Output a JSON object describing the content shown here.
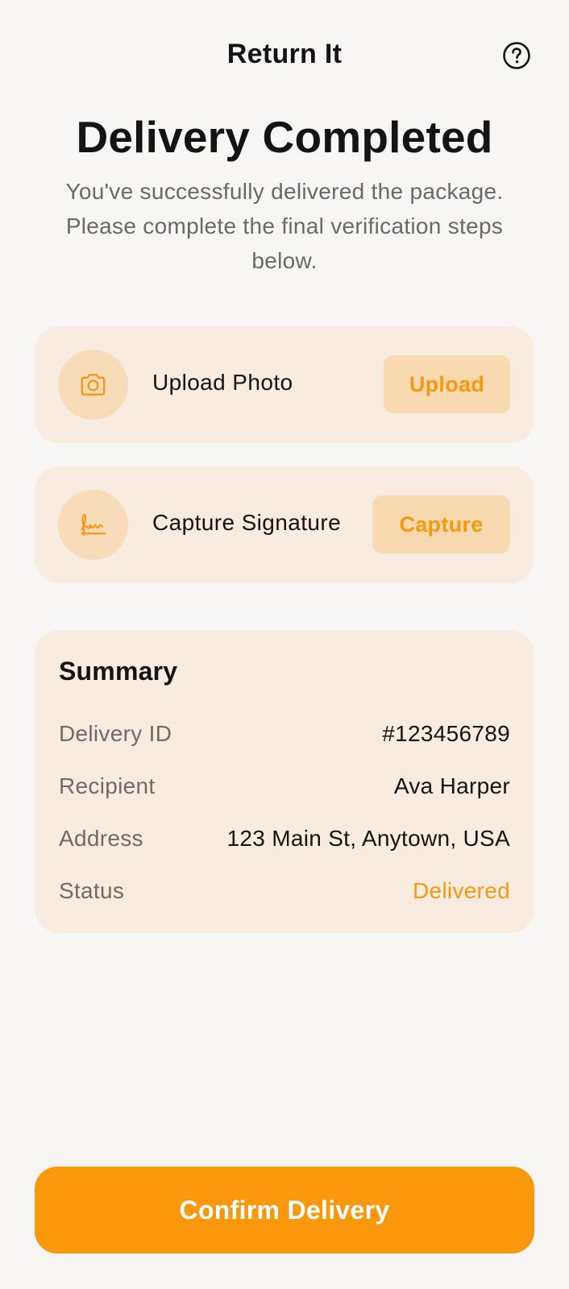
{
  "header": {
    "title": "Return It",
    "help_icon": "help-circle-icon"
  },
  "main": {
    "title": "Delivery Completed",
    "subtitle": "You've successfully delivered the package. Please complete the final verification steps below."
  },
  "actions": [
    {
      "icon": "camera-icon",
      "label": "Upload Photo",
      "button": "Upload"
    },
    {
      "icon": "signature-icon",
      "label": "Capture Signature",
      "button": "Capture"
    }
  ],
  "summary": {
    "title": "Summary",
    "rows": [
      {
        "label": "Delivery ID",
        "value": "#123456789"
      },
      {
        "label": "Recipient",
        "value": "Ava Harper"
      },
      {
        "label": "Address",
        "value": "123 Main St, Anytown, USA"
      },
      {
        "label": "Status",
        "value": "Delivered"
      }
    ]
  },
  "footer": {
    "confirm_label": "Confirm Delivery"
  },
  "colors": {
    "background": "#f8f6f4",
    "card": "#f8ebdf",
    "accent": "#f8980e",
    "accent_soft": "#f8d9b0"
  }
}
